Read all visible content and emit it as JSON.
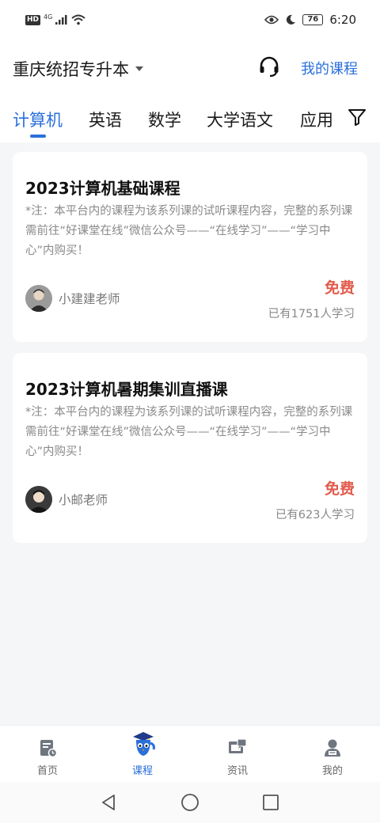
{
  "status_bar": {
    "hd": "HD",
    "network": "4G",
    "battery": "76",
    "time": "6:20"
  },
  "header": {
    "region": "重庆统招专升本",
    "my_courses": "我的课程"
  },
  "tabs": [
    {
      "label": "计算机",
      "active": true
    },
    {
      "label": "英语"
    },
    {
      "label": "数学"
    },
    {
      "label": "大学语文"
    },
    {
      "label": "应用"
    }
  ],
  "courses": [
    {
      "title": "2023计算机基础课程",
      "note": "*注：本平台内的课程为该系列课的试听课程内容，完整的系列课需前往“好课堂在线”微信公众号——“在线学习”——“学习中心”内购买！",
      "teacher": "小建建老师",
      "price": "免费",
      "learners": "已有1751人学习"
    },
    {
      "title": "2023计算机暑期集训直播课",
      "note": "*注：本平台内的课程为该系列课的试听课程内容，完整的系列课需前往“好课堂在线”微信公众号——“在线学习”——“学习中心”内购买！",
      "teacher": "小邮老师",
      "price": "免费",
      "learners": "已有623人学习"
    }
  ],
  "bottom_nav": [
    {
      "label": "首页",
      "icon": "home-icon"
    },
    {
      "label": "课程",
      "icon": "course-mascot-icon",
      "active": true
    },
    {
      "label": "资讯",
      "icon": "news-icon"
    },
    {
      "label": "我的",
      "icon": "profile-icon"
    }
  ],
  "colors": {
    "accent": "#2a6fdb",
    "price": "#e25b4d",
    "background": "#f5f6f8"
  }
}
